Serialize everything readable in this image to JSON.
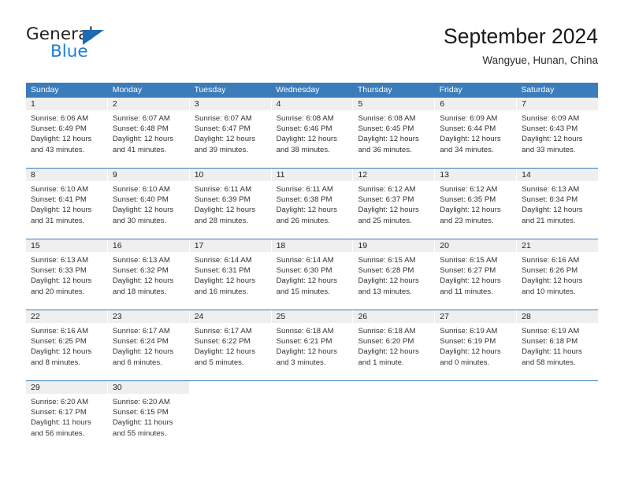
{
  "brand": {
    "name_top": "General",
    "name_bottom": "Blue",
    "accent_color": "#1b7ed6",
    "triangle_color": "#1b6bb5"
  },
  "header": {
    "title": "September 2024",
    "subtitle": "Wangyue, Hunan, China",
    "header_bg": "#3b7cba",
    "header_text_color": "#ffffff"
  },
  "weekdays": [
    "Sunday",
    "Monday",
    "Tuesday",
    "Wednesday",
    "Thursday",
    "Friday",
    "Saturday"
  ],
  "weeks": [
    [
      {
        "date": "1",
        "sunrise": "Sunrise: 6:06 AM",
        "sunset": "Sunset: 6:49 PM",
        "daylight_1": "Daylight: 12 hours",
        "daylight_2": "and 43 minutes."
      },
      {
        "date": "2",
        "sunrise": "Sunrise: 6:07 AM",
        "sunset": "Sunset: 6:48 PM",
        "daylight_1": "Daylight: 12 hours",
        "daylight_2": "and 41 minutes."
      },
      {
        "date": "3",
        "sunrise": "Sunrise: 6:07 AM",
        "sunset": "Sunset: 6:47 PM",
        "daylight_1": "Daylight: 12 hours",
        "daylight_2": "and 39 minutes."
      },
      {
        "date": "4",
        "sunrise": "Sunrise: 6:08 AM",
        "sunset": "Sunset: 6:46 PM",
        "daylight_1": "Daylight: 12 hours",
        "daylight_2": "and 38 minutes."
      },
      {
        "date": "5",
        "sunrise": "Sunrise: 6:08 AM",
        "sunset": "Sunset: 6:45 PM",
        "daylight_1": "Daylight: 12 hours",
        "daylight_2": "and 36 minutes."
      },
      {
        "date": "6",
        "sunrise": "Sunrise: 6:09 AM",
        "sunset": "Sunset: 6:44 PM",
        "daylight_1": "Daylight: 12 hours",
        "daylight_2": "and 34 minutes."
      },
      {
        "date": "7",
        "sunrise": "Sunrise: 6:09 AM",
        "sunset": "Sunset: 6:43 PM",
        "daylight_1": "Daylight: 12 hours",
        "daylight_2": "and 33 minutes."
      }
    ],
    [
      {
        "date": "8",
        "sunrise": "Sunrise: 6:10 AM",
        "sunset": "Sunset: 6:41 PM",
        "daylight_1": "Daylight: 12 hours",
        "daylight_2": "and 31 minutes."
      },
      {
        "date": "9",
        "sunrise": "Sunrise: 6:10 AM",
        "sunset": "Sunset: 6:40 PM",
        "daylight_1": "Daylight: 12 hours",
        "daylight_2": "and 30 minutes."
      },
      {
        "date": "10",
        "sunrise": "Sunrise: 6:11 AM",
        "sunset": "Sunset: 6:39 PM",
        "daylight_1": "Daylight: 12 hours",
        "daylight_2": "and 28 minutes."
      },
      {
        "date": "11",
        "sunrise": "Sunrise: 6:11 AM",
        "sunset": "Sunset: 6:38 PM",
        "daylight_1": "Daylight: 12 hours",
        "daylight_2": "and 26 minutes."
      },
      {
        "date": "12",
        "sunrise": "Sunrise: 6:12 AM",
        "sunset": "Sunset: 6:37 PM",
        "daylight_1": "Daylight: 12 hours",
        "daylight_2": "and 25 minutes."
      },
      {
        "date": "13",
        "sunrise": "Sunrise: 6:12 AM",
        "sunset": "Sunset: 6:35 PM",
        "daylight_1": "Daylight: 12 hours",
        "daylight_2": "and 23 minutes."
      },
      {
        "date": "14",
        "sunrise": "Sunrise: 6:13 AM",
        "sunset": "Sunset: 6:34 PM",
        "daylight_1": "Daylight: 12 hours",
        "daylight_2": "and 21 minutes."
      }
    ],
    [
      {
        "date": "15",
        "sunrise": "Sunrise: 6:13 AM",
        "sunset": "Sunset: 6:33 PM",
        "daylight_1": "Daylight: 12 hours",
        "daylight_2": "and 20 minutes."
      },
      {
        "date": "16",
        "sunrise": "Sunrise: 6:13 AM",
        "sunset": "Sunset: 6:32 PM",
        "daylight_1": "Daylight: 12 hours",
        "daylight_2": "and 18 minutes."
      },
      {
        "date": "17",
        "sunrise": "Sunrise: 6:14 AM",
        "sunset": "Sunset: 6:31 PM",
        "daylight_1": "Daylight: 12 hours",
        "daylight_2": "and 16 minutes."
      },
      {
        "date": "18",
        "sunrise": "Sunrise: 6:14 AM",
        "sunset": "Sunset: 6:30 PM",
        "daylight_1": "Daylight: 12 hours",
        "daylight_2": "and 15 minutes."
      },
      {
        "date": "19",
        "sunrise": "Sunrise: 6:15 AM",
        "sunset": "Sunset: 6:28 PM",
        "daylight_1": "Daylight: 12 hours",
        "daylight_2": "and 13 minutes."
      },
      {
        "date": "20",
        "sunrise": "Sunrise: 6:15 AM",
        "sunset": "Sunset: 6:27 PM",
        "daylight_1": "Daylight: 12 hours",
        "daylight_2": "and 11 minutes."
      },
      {
        "date": "21",
        "sunrise": "Sunrise: 6:16 AM",
        "sunset": "Sunset: 6:26 PM",
        "daylight_1": "Daylight: 12 hours",
        "daylight_2": "and 10 minutes."
      }
    ],
    [
      {
        "date": "22",
        "sunrise": "Sunrise: 6:16 AM",
        "sunset": "Sunset: 6:25 PM",
        "daylight_1": "Daylight: 12 hours",
        "daylight_2": "and 8 minutes."
      },
      {
        "date": "23",
        "sunrise": "Sunrise: 6:17 AM",
        "sunset": "Sunset: 6:24 PM",
        "daylight_1": "Daylight: 12 hours",
        "daylight_2": "and 6 minutes."
      },
      {
        "date": "24",
        "sunrise": "Sunrise: 6:17 AM",
        "sunset": "Sunset: 6:22 PM",
        "daylight_1": "Daylight: 12 hours",
        "daylight_2": "and 5 minutes."
      },
      {
        "date": "25",
        "sunrise": "Sunrise: 6:18 AM",
        "sunset": "Sunset: 6:21 PM",
        "daylight_1": "Daylight: 12 hours",
        "daylight_2": "and 3 minutes."
      },
      {
        "date": "26",
        "sunrise": "Sunrise: 6:18 AM",
        "sunset": "Sunset: 6:20 PM",
        "daylight_1": "Daylight: 12 hours",
        "daylight_2": "and 1 minute."
      },
      {
        "date": "27",
        "sunrise": "Sunrise: 6:19 AM",
        "sunset": "Sunset: 6:19 PM",
        "daylight_1": "Daylight: 12 hours",
        "daylight_2": "and 0 minutes."
      },
      {
        "date": "28",
        "sunrise": "Sunrise: 6:19 AM",
        "sunset": "Sunset: 6:18 PM",
        "daylight_1": "Daylight: 11 hours",
        "daylight_2": "and 58 minutes."
      }
    ],
    [
      {
        "date": "29",
        "sunrise": "Sunrise: 6:20 AM",
        "sunset": "Sunset: 6:17 PM",
        "daylight_1": "Daylight: 11 hours",
        "daylight_2": "and 56 minutes."
      },
      {
        "date": "30",
        "sunrise": "Sunrise: 6:20 AM",
        "sunset": "Sunset: 6:15 PM",
        "daylight_1": "Daylight: 11 hours",
        "daylight_2": "and 55 minutes."
      },
      {
        "date": "",
        "sunrise": "",
        "sunset": "",
        "daylight_1": "",
        "daylight_2": ""
      },
      {
        "date": "",
        "sunrise": "",
        "sunset": "",
        "daylight_1": "",
        "daylight_2": ""
      },
      {
        "date": "",
        "sunrise": "",
        "sunset": "",
        "daylight_1": "",
        "daylight_2": ""
      },
      {
        "date": "",
        "sunrise": "",
        "sunset": "",
        "daylight_1": "",
        "daylight_2": ""
      },
      {
        "date": "",
        "sunrise": "",
        "sunset": "",
        "daylight_1": "",
        "daylight_2": ""
      }
    ]
  ]
}
